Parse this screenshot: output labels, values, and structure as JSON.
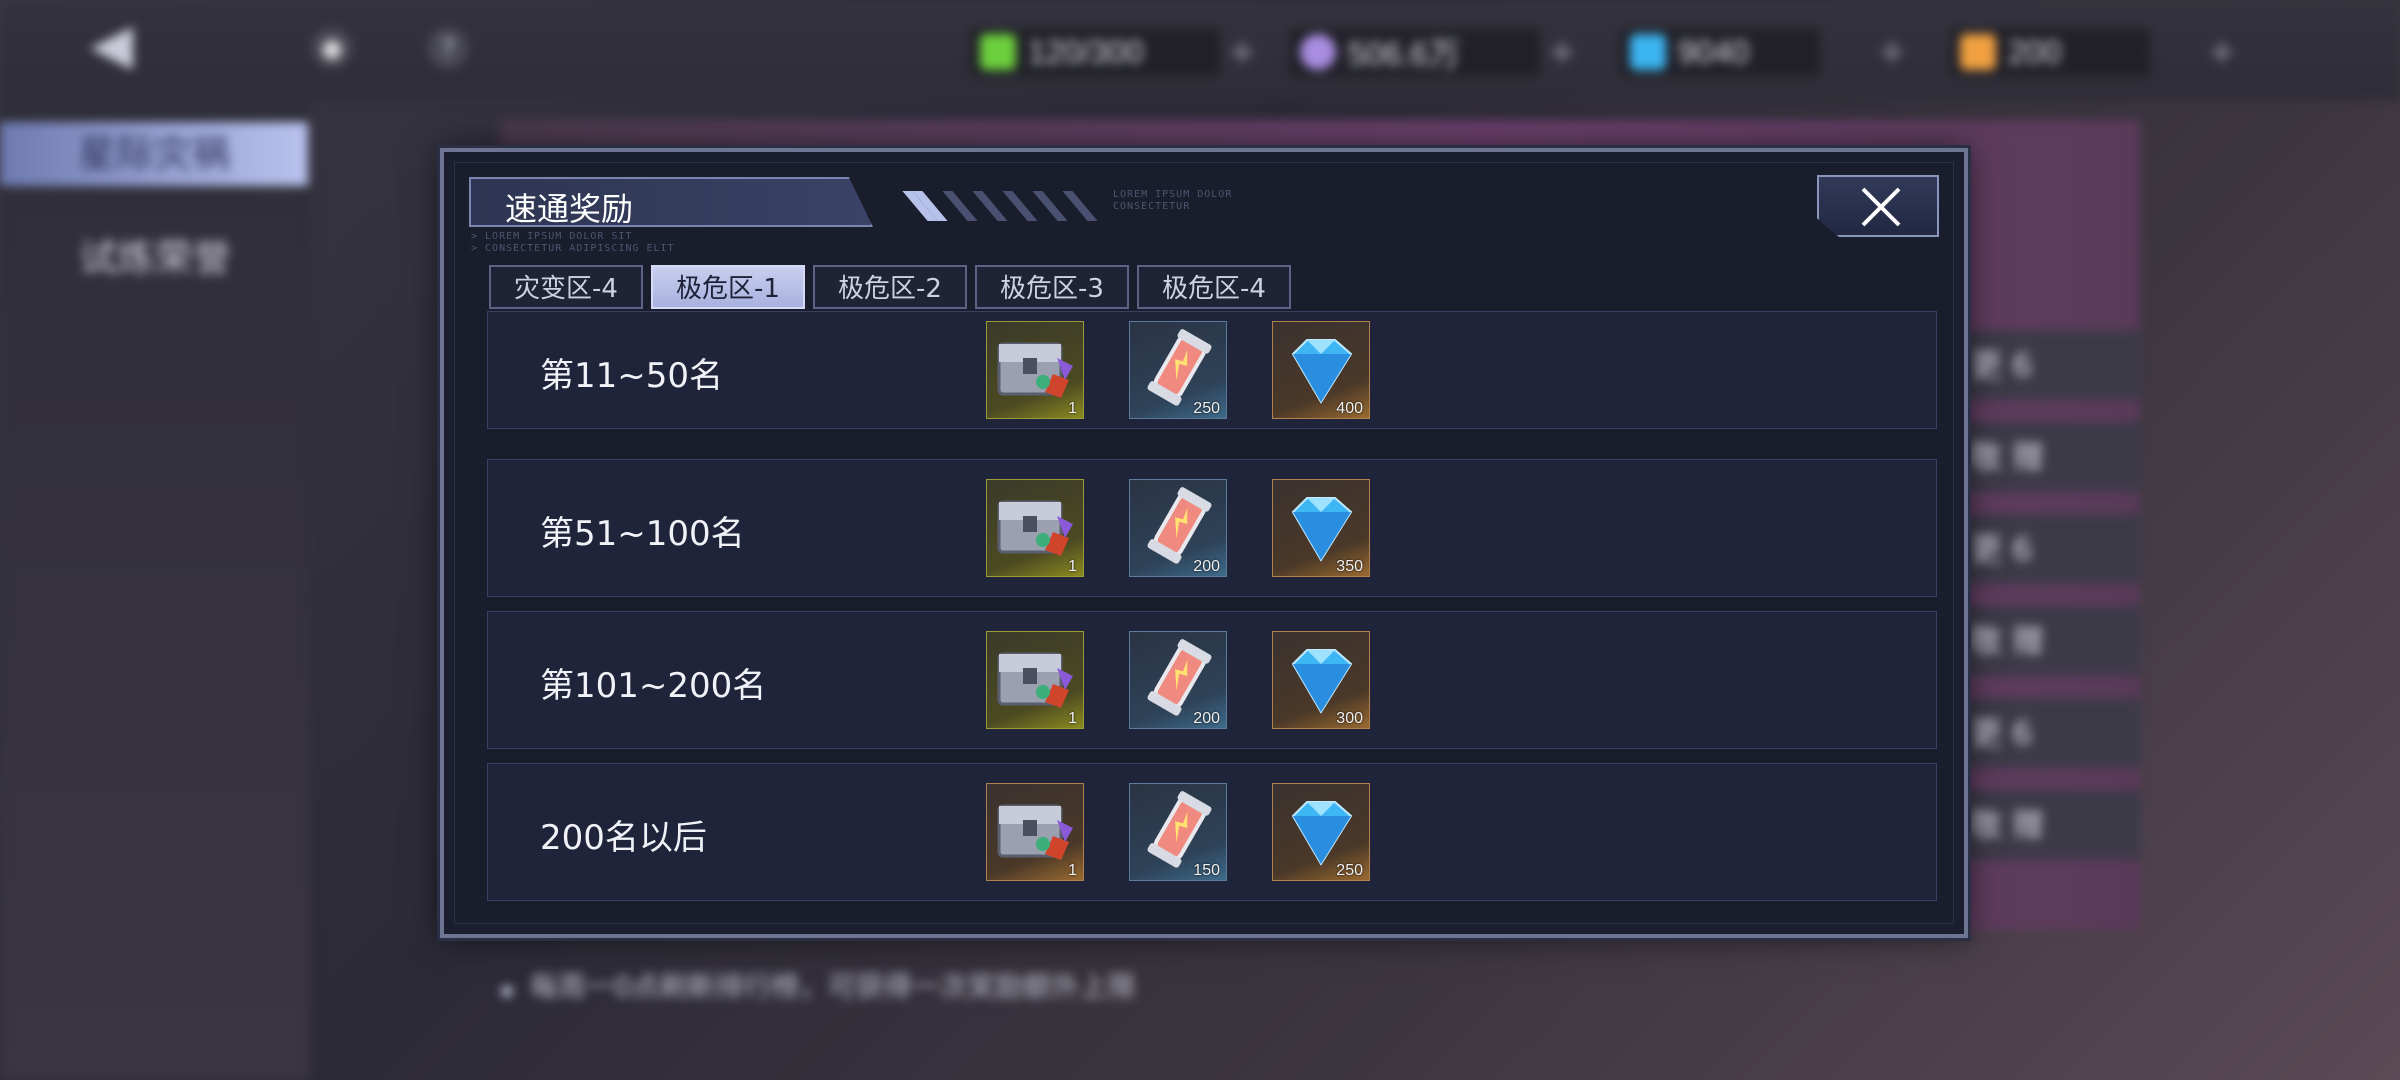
{
  "topbar": {
    "resources": [
      {
        "name": "stamina",
        "icon": "energy-bottle-icon",
        "value": "120/300",
        "color": "#6ccf3c"
      },
      {
        "name": "gold",
        "icon": "crystal-ball-icon",
        "value": "506.6万",
        "color": "#a88de0"
      },
      {
        "name": "gems",
        "icon": "blue-diamond-icon",
        "value": "9040",
        "color": "#3ab4f0"
      },
      {
        "name": "tickets",
        "icon": "ticket-icon",
        "value": "200",
        "color": "#f0a040"
      }
    ]
  },
  "sidebar": {
    "items": [
      {
        "label": "星际灾祸"
      },
      {
        "label": "试炼荣誉"
      }
    ]
  },
  "background": {
    "list": [
      "更 6",
      "敬 赠",
      "更 6",
      "敬 赠",
      "更 6",
      "敬 赠"
    ],
    "note": "每周一0点刷新排行榜，可获得一次奖励额外上限"
  },
  "dialog": {
    "title": "速通奖励",
    "lorem1": "LOREM IPSUM DOLOR\nCONSECTETUR",
    "lorem2": "> LOREM IPSUM DOLOR SIT\n> CONSECTETUR ADIPISCING ELIT",
    "tabs": [
      "灾变区-4",
      "极危区-1",
      "极危区-2",
      "极危区-3",
      "极危区-4"
    ],
    "active_tab": 1,
    "rows": [
      {
        "label": "第11~50名",
        "rewards": [
          {
            "icon": "chest-icon",
            "count": "1",
            "rarity": "yellow"
          },
          {
            "icon": "energy-capsule-icon",
            "count": "250",
            "rarity": "blue"
          },
          {
            "icon": "diamond-icon",
            "count": "400",
            "rarity": "orange"
          }
        ]
      },
      {
        "label": "第51~100名",
        "rewards": [
          {
            "icon": "chest-icon",
            "count": "1",
            "rarity": "yellow"
          },
          {
            "icon": "energy-capsule-icon",
            "count": "200",
            "rarity": "blue"
          },
          {
            "icon": "diamond-icon",
            "count": "350",
            "rarity": "orange"
          }
        ]
      },
      {
        "label": "第101~200名",
        "rewards": [
          {
            "icon": "chest-icon",
            "count": "1",
            "rarity": "yellow"
          },
          {
            "icon": "energy-capsule-icon",
            "count": "200",
            "rarity": "blue"
          },
          {
            "icon": "diamond-icon",
            "count": "300",
            "rarity": "orange"
          }
        ]
      },
      {
        "label": "200名以后",
        "rewards": [
          {
            "icon": "chest-icon",
            "count": "1",
            "rarity": "orange"
          },
          {
            "icon": "energy-capsule-icon",
            "count": "150",
            "rarity": "blue"
          },
          {
            "icon": "diamond-icon",
            "count": "250",
            "rarity": "orange"
          }
        ]
      }
    ]
  }
}
